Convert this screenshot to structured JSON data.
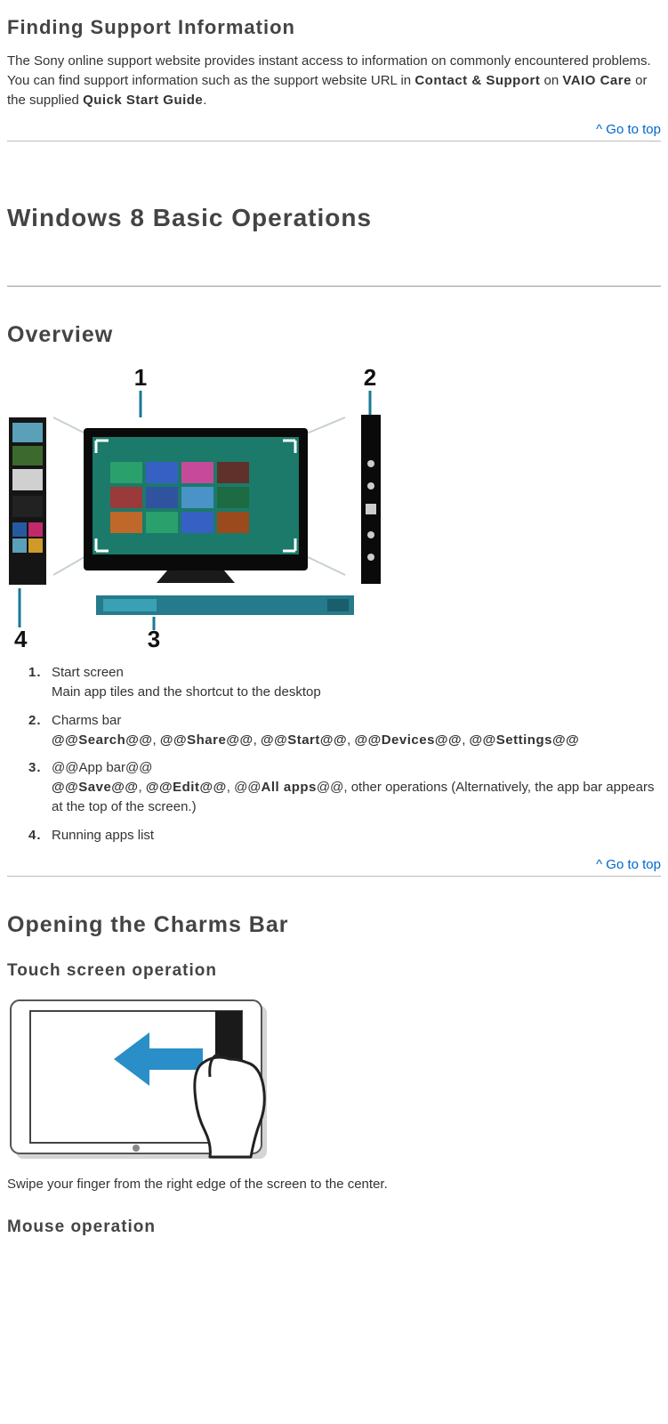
{
  "section1": {
    "heading": "Finding Support Information",
    "para_pre": "The Sony online support website provides instant access to information on commonly encountered problems. You can find support information such as the support website URL in ",
    "bold1": "Contact & Support",
    "mid1": " on ",
    "bold2": "VAIO Care",
    "mid2": " or the supplied ",
    "bold3": "Quick Start Guide",
    "tail": "."
  },
  "go_to_top": "^ Go to top",
  "section2": {
    "heading": "Windows 8 Basic Operations"
  },
  "overview": {
    "heading": "Overview",
    "callout_1": "1",
    "callout_2": "2",
    "callout_3": "3",
    "callout_4": "4",
    "items": {
      "n1": "1.",
      "t1a": "Start screen",
      "t1b": "Main app tiles and the shortcut to the desktop",
      "n2": "2.",
      "t2a": "Charms bar",
      "t2_search": "@@Search@@",
      "t2_share": "@@Share@@",
      "t2_start": "@@Start@@",
      "t2_devices": "@@Devices@@",
      "t2_settings": "@@Settings@@",
      "n3": "3.",
      "t3a_pre": "@@",
      "t3a_mid": "App bar",
      "t3a_post": "@@",
      "t3_save": "@@Save@@",
      "t3_edit": "@@Edit@@",
      "t3_all_pre": "@@",
      "t3_all_mid": "All apps",
      "t3_all_post": "@@",
      "t3_tail": ", other operations (Alternatively, the app bar appears at the top of the screen.)",
      "n4": "4.",
      "t4a": "Running apps list"
    }
  },
  "charms_section": {
    "heading": "Opening the Charms Bar",
    "touch_heading": "Touch screen operation",
    "touch_text": "Swipe your finger from the right edge of the screen to the center.",
    "mouse_heading": "Mouse operation"
  }
}
